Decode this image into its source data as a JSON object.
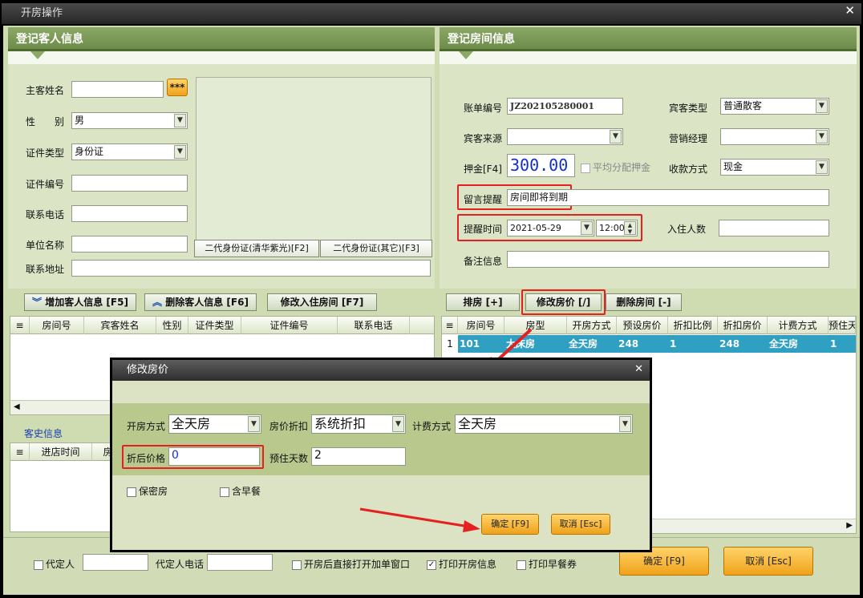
{
  "window": {
    "title": "开房操作"
  },
  "guest_panel": {
    "title": "登记客人信息",
    "name_label": "主客姓名",
    "name_btn": "***",
    "gender_label": "性　　别",
    "gender_value": "男",
    "idtype_label": "证件类型",
    "idtype_value": "身份证",
    "idno_label": "证件编号",
    "phone_label": "联系电话",
    "company_label": "单位名称",
    "address_label": "联系地址",
    "idcard_btn1": "二代身份证(清华紫光)[F2]",
    "idcard_btn2": "二代身份证(其它)[F3]"
  },
  "guest_actions": {
    "add": "增加客人信息 [F5]",
    "delete": "删除客人信息 [F6]",
    "modify": "修改入住房间 [F7]"
  },
  "guest_table": {
    "columns": [
      "房间号",
      "宾客姓名",
      "性别",
      "证件类型",
      "证件编号",
      "联系电话"
    ]
  },
  "history": {
    "label": "客史信息",
    "columns": [
      "进店时间",
      "房"
    ]
  },
  "room_panel": {
    "title": "登记房间信息",
    "bill_label": "账单编号",
    "bill_value": "JZ202105280001",
    "guest_type_label": "宾客类型",
    "guest_type_value": "普通散客",
    "source_label": "宾客来源",
    "source_value": "",
    "sales_label": "营销经理",
    "sales_value": "",
    "deposit_label": "押金[F4]",
    "deposit_value": "300.00",
    "avg_deposit_label": "平均分配押金",
    "payment_label": "收款方式",
    "payment_value": "现金",
    "message_label": "留言提醒",
    "message_value": "房间即将到期",
    "remind_label": "提醒时间",
    "remind_date": "2021-05-29",
    "remind_time": "12:00",
    "people_label": "入住人数",
    "remark_label": "备注信息"
  },
  "room_actions": {
    "arrange": "排房 [+]",
    "modify_price": "修改房价 [/]",
    "delete_room": "删除房间 [-]"
  },
  "room_table": {
    "columns": [
      "房间号",
      "房型",
      "开房方式",
      "预设房价",
      "折扣比例",
      "折扣房价",
      "计费方式",
      "预住天"
    ],
    "rows": [
      {
        "no": "1",
        "cells": [
          "101",
          "大床房",
          "全天房",
          "248",
          "1",
          "248",
          "全天房",
          "1"
        ]
      }
    ]
  },
  "dialog": {
    "title": "修改房价",
    "open_mode_label": "开房方式",
    "open_mode_value": "全天房",
    "discount_label": "房价折扣",
    "discount_value": "系统折扣",
    "billing_label": "计费方式",
    "billing_value": "全天房",
    "price_label": "折后价格",
    "price_value": "0",
    "days_label": "预住天数",
    "days_value": "2",
    "secret_label": "保密房",
    "breakfast_label": "含早餐",
    "ok": "确定 [F9]",
    "cancel": "取消 [Esc]"
  },
  "footer": {
    "agent_label": "代定人",
    "agent_phone_label": "代定人电话",
    "open_bill_label": "开房后直接打开加单窗口",
    "print_label": "打印开房信息",
    "print_checked": "✓",
    "breakfast_label": "打印早餐券",
    "ok": "确定 [F9]",
    "cancel": "取消 [Esc]"
  }
}
